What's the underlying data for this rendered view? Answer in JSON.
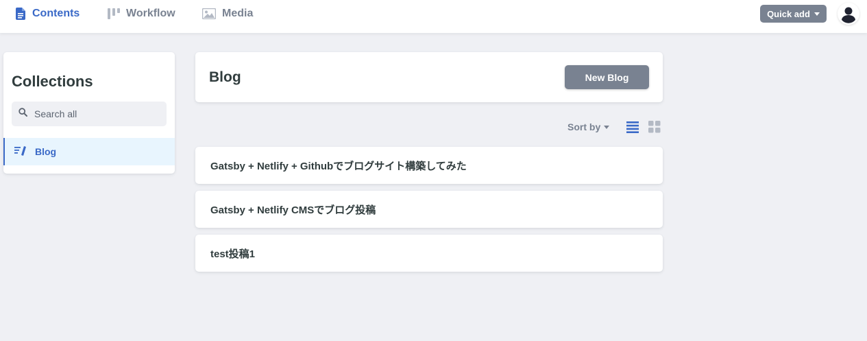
{
  "nav": {
    "tabs": [
      {
        "label": "Contents",
        "icon": "document-icon",
        "active": true
      },
      {
        "label": "Workflow",
        "icon": "workflow-icon",
        "active": false
      },
      {
        "label": "Media",
        "icon": "image-icon",
        "active": false
      }
    ],
    "quick_add_label": "Quick add"
  },
  "sidebar": {
    "title": "Collections",
    "search_placeholder": "Search all",
    "collections": [
      {
        "label": "Blog",
        "icon": "write-icon",
        "selected": true
      }
    ]
  },
  "main": {
    "collection_title": "Blog",
    "new_button_label": "New Blog",
    "sort_label": "Sort by",
    "view_mode": "list",
    "entries": [
      {
        "title": "Gatsby + Netlify + Githubでブログサイト構築してみた"
      },
      {
        "title": "Gatsby + Netlify CMSでブログ投稿"
      },
      {
        "title": "test投稿1"
      }
    ]
  },
  "colors": {
    "accent": "#3a69c7",
    "muted": "#798291",
    "background": "#eff0f4",
    "selected_bg": "#e8f5fe",
    "text": "#313d3e"
  }
}
